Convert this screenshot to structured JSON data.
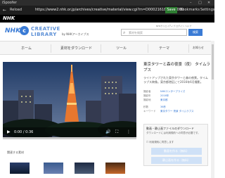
{
  "window": {
    "title": "iSpoofer",
    "min": "–",
    "max": "□",
    "close": "✕"
  },
  "toolbar": {
    "back": "←",
    "reload": "Reload",
    "url": "https://www2.nhk.or.jp/archives/creative/material/view.cgi?m=D0002161815_00000",
    "save": "Save",
    "bookmarks": "Bookmarks",
    "settings": "Settings"
  },
  "nhk_logo": "NHK",
  "brand": {
    "nhk": "NHK",
    "creative": "CREATIVE",
    "library": "LIBRARY",
    "sub": "by NHKアーカイブス"
  },
  "util_links": "NHKクリエイティブ  ログイン  ヘルプ",
  "search": {
    "placeholder": "素材を検索",
    "button": "検索"
  },
  "nav": {
    "items": [
      "ホーム",
      "素材をダウンロード",
      "ツール",
      "テーマ",
      "お知らせ"
    ]
  },
  "breadcrumb": "",
  "video": {
    "time": "0:00 / 0:36"
  },
  "material": {
    "title": "東京タワーと森の夜景（夜） タイムラプス",
    "description": "ライトアップされた東京タワーと森の夜景。タイムラプス映像。東京都港区にて2016年6月撮影。",
    "meta": [
      {
        "label": "撮影者",
        "value": "NHKエンタープライズ"
      },
      {
        "label": "撮影年",
        "value": "2016年"
      },
      {
        "label": "撮影地",
        "value": "東京都"
      },
      {
        "label": "秒数",
        "value": "36秒"
      },
      {
        "label": "キーワード",
        "value": "東京タワー 夜景 タイムラプス"
      }
    ]
  },
  "download": {
    "heading": "動画・静止画ファイルのダウンロード",
    "text": "ダウンロードには利用規約への同意が必要です。",
    "checkbox": "利用規約に同意します",
    "btn1": "動画を作る（無料）",
    "btn2": "静止画を作る（無料）"
  },
  "related": {
    "heading": "関連する素材"
  },
  "colors": {
    "accent": "#3a7bd5",
    "save": "#2e7d32"
  }
}
